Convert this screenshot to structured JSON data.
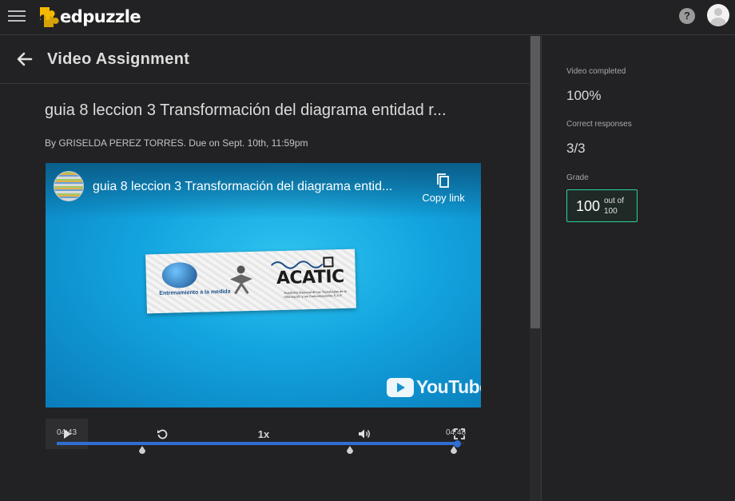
{
  "app": {
    "logo_text": "edpuzzle",
    "help_label": "?"
  },
  "header": {
    "title": "Video Assignment"
  },
  "assignment": {
    "title": "guia 8 leccion 3 Transformación del diagrama entidad r...",
    "meta": "By GRISELDA PEREZ TORRES. Due on Sept. 10th, 11:59pm"
  },
  "player": {
    "title": "guia 8 leccion 3 Transformación del diagrama entid...",
    "copy_link_label": "Copy link",
    "banner_left_text": "Entrenamiento a la medida",
    "banner_brand": "ACATIC",
    "banner_brand_sub": "Academia Nacional de las Tecnologías de la Información y las Comunicaciones S.A.S",
    "youtube_label": "YouTube",
    "speed_label": "1x",
    "current_time": "04:43",
    "total_time": "04:48",
    "progress_fraction": 0.983,
    "question_markers": [
      0.21,
      0.72,
      0.975
    ],
    "colors": {
      "progress": "#2f6fd1",
      "player_bg": "#12a3de"
    }
  },
  "stats": {
    "video_completed_label": "Video completed",
    "video_completed_value": "100%",
    "correct_responses_label": "Correct responses",
    "correct_responses_value": "3/3",
    "grade_label": "Grade",
    "grade_value": "100",
    "grade_out_of_line1": "out of",
    "grade_out_of_line2": "100",
    "grade_accent": "#2bd19e"
  },
  "icons": {
    "menu": "hamburger-menu-icon",
    "back": "arrow-left-icon",
    "help": "question-circle-icon",
    "copy": "copy-icon",
    "play": "play-icon",
    "rewind": "rewind-icon",
    "volume": "volume-icon",
    "fullscreen": "fullscreen-icon"
  }
}
